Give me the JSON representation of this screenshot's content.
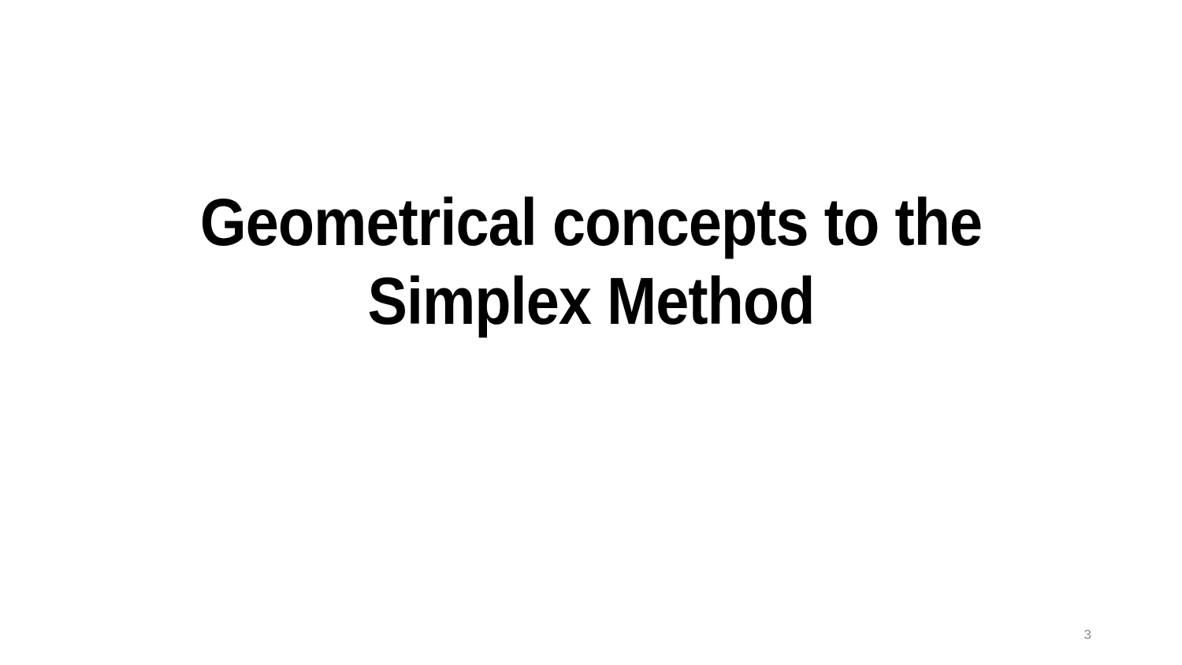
{
  "slide": {
    "title_lines": [
      "Geometrical concepts to the",
      "Simplex Method"
    ],
    "page_number": "3"
  },
  "colors": {
    "background": "#ffffff",
    "title": "#000000",
    "page_number": "#8c8c8c"
  }
}
